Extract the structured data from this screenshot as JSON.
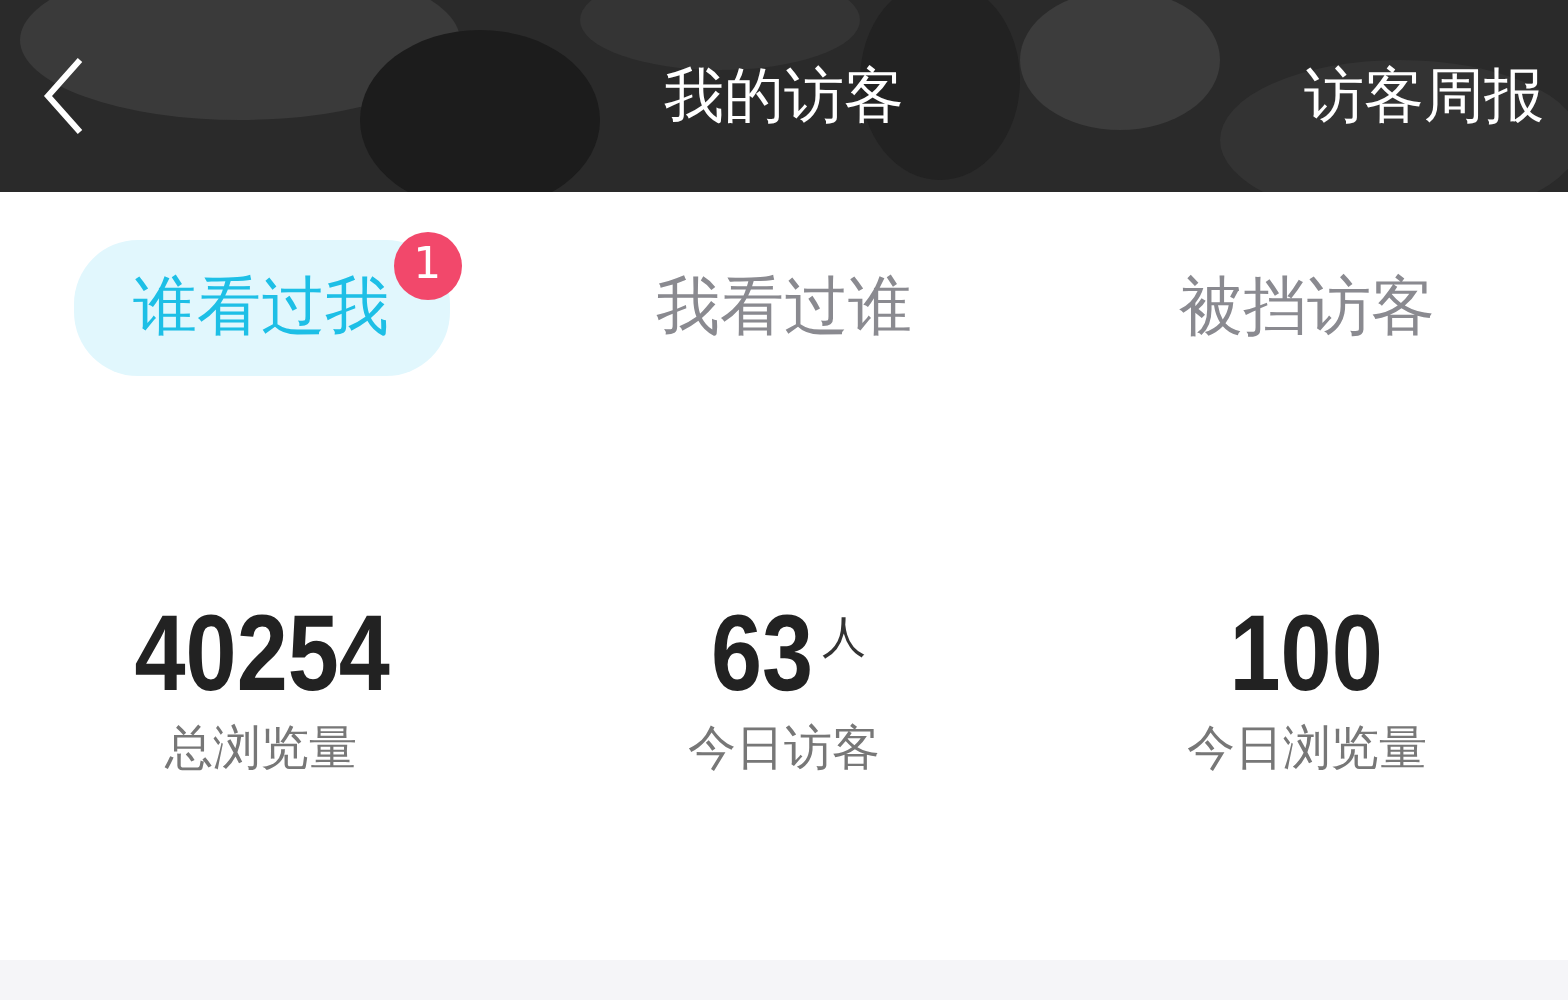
{
  "header": {
    "title": "我的访客",
    "action": "访客周报"
  },
  "tabs": [
    {
      "label": "谁看过我",
      "selected": true,
      "badge": "1"
    },
    {
      "label": "我看过谁",
      "selected": false
    },
    {
      "label": "被挡访客",
      "selected": false
    }
  ],
  "stats": [
    {
      "value": "40254",
      "label": "总浏览量"
    },
    {
      "value": "63",
      "unit": "人",
      "label": "今日访客"
    },
    {
      "value": "100",
      "label": "今日浏览量"
    }
  ]
}
